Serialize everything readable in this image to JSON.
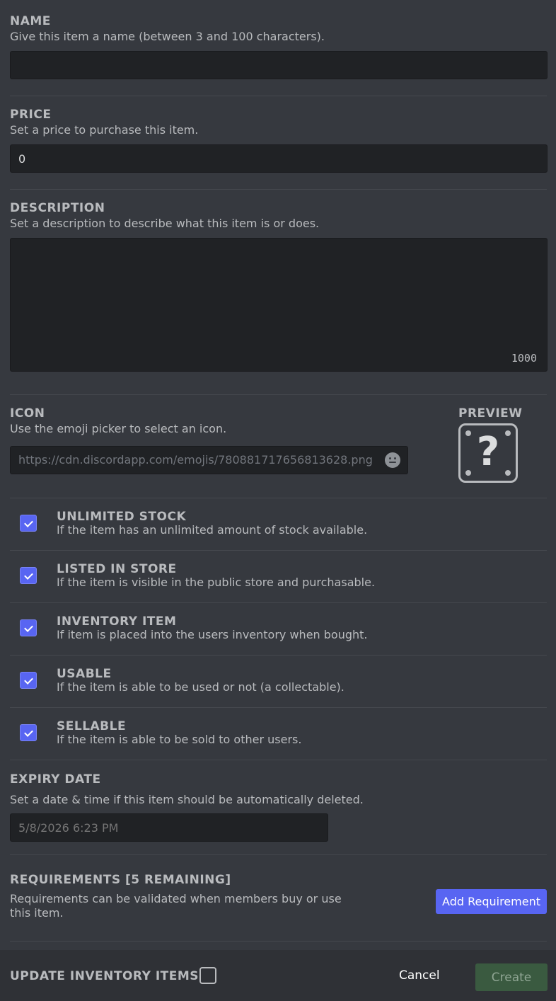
{
  "name": {
    "label": "NAME",
    "hint": "Give this item a name (between 3 and 100 characters).",
    "value": ""
  },
  "price": {
    "label": "PRICE",
    "hint": "Set a price to purchase this item.",
    "value": "0"
  },
  "description": {
    "label": "DESCRIPTION",
    "hint": "Set a description to describe what this item is or does.",
    "value": "",
    "counter": "1000"
  },
  "icon": {
    "label": "ICON",
    "hint": "Use the emoji picker to select an icon.",
    "value": "https://cdn.discordapp.com/emojis/780881717656813628.png",
    "emoji_icon": "smiley-face-icon",
    "preview_label": "PREVIEW",
    "preview_glyph": "?"
  },
  "options": [
    {
      "label": "UNLIMITED STOCK",
      "hint": "If the item has an unlimited amount of stock available.",
      "checked": true
    },
    {
      "label": "LISTED IN STORE",
      "hint": "If the item is visible in the public store and purchasable.",
      "checked": true
    },
    {
      "label": "INVENTORY ITEM",
      "hint": "If item is placed into the users inventory when bought.",
      "checked": true
    },
    {
      "label": "USABLE",
      "hint": "If the item is able to be used or not (a collectable).",
      "checked": true
    },
    {
      "label": "SELLABLE",
      "hint": "If the item is able to be sold to other users.",
      "checked": true
    }
  ],
  "expiry": {
    "label": "EXPIRY DATE",
    "hint": "Set a date & time if this item should be automatically deleted.",
    "placeholder": "5/8/2026 6:23 PM"
  },
  "requirements": {
    "label": "REQUIREMENTS [5 REMAINING]",
    "hint": "Requirements can be validated when members buy or use this item.",
    "add_button": "Add Requirement"
  },
  "footer": {
    "update_label": "UPDATE INVENTORY ITEMS",
    "update_checked": false,
    "cancel": "Cancel",
    "create": "Create"
  },
  "colors": {
    "background": "#36393f",
    "input": "#202225",
    "accent": "#5865f2",
    "create_disabled": "#3a5a40",
    "footer": "#2f3136"
  }
}
